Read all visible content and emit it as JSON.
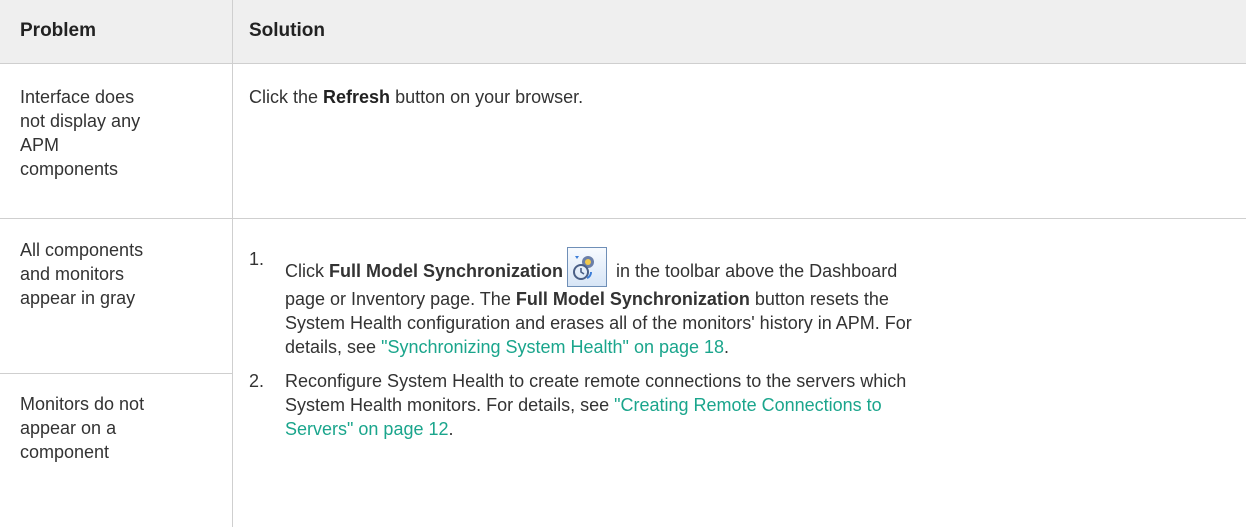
{
  "header": {
    "problem": "Problem",
    "solution": "Solution"
  },
  "rows": [
    {
      "problem": [
        "Interface does",
        "not display any",
        "APM",
        "components"
      ],
      "solution": {
        "pre": "Click the ",
        "bold": "Refresh",
        "post": " button on your browser."
      }
    },
    {
      "problem": [
        "All components",
        "and monitors",
        "appear in gray"
      ]
    },
    {
      "problem": [
        "Monitors do not",
        "appear on a",
        "component"
      ]
    }
  ],
  "steps": [
    {
      "num": "1.",
      "line1_pre": "Click ",
      "line1_bold": "Full Model Synchronization",
      "line1_post": " in the toolbar above the Dashboard",
      "line2_pre": "page or Inventory page. The ",
      "line2_bold": "Full Model Synchronization",
      "line2_post": " button resets the",
      "line3": "System Health configuration and erases all of the monitors' history in APM. For",
      "line4_pre": "details, see ",
      "line4_link": "\"Synchronizing System Health\" on page 18",
      "line4_post": "."
    },
    {
      "num": "2.",
      "line1": "Reconfigure System Health to create remote connections to the servers which",
      "line2_pre": "System Health monitors. For details, see ",
      "line2_link": "\"Creating Remote Connections to",
      "line3_link": "Servers\" on page 12",
      "line3_post": "."
    }
  ],
  "icons": {
    "sync": "full-model-synchronization-icon"
  },
  "colors": {
    "link": "#1aa58c",
    "header_bg": "#efefef",
    "border": "#cfcfcf"
  }
}
